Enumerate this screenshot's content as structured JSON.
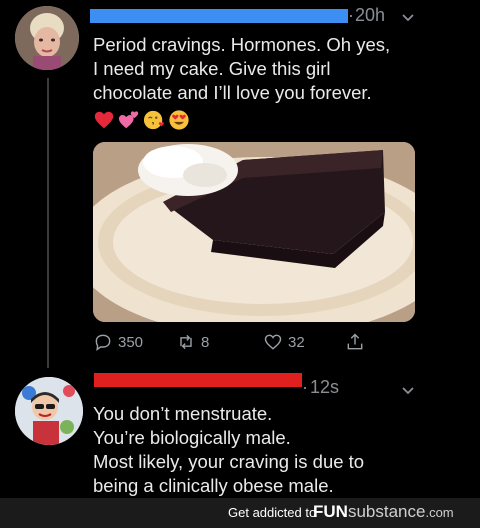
{
  "tweets": [
    {
      "time": "20h",
      "dot": "·",
      "lines": [
        "Period cravings. Hormones. Oh yes,",
        "I need my cake. Give this girl",
        "chocolate and I’ll love you forever."
      ],
      "emojis": [
        "red-heart",
        "two-hearts",
        "face-blowing-kiss",
        "heart-eyes-face"
      ],
      "stats": {
        "replies": "350",
        "retweets": "8",
        "likes": "32"
      },
      "icons": [
        "reply-icon",
        "retweet-icon",
        "like-icon",
        "share-icon"
      ]
    },
    {
      "time": "12s",
      "dot": "·",
      "lines": [
        "You don’t menstruate.",
        "You’re biologically male.",
        "Most likely, your craving is due to",
        "being a clinically obese male."
      ]
    }
  ],
  "watermark": {
    "text": "Get addicted to",
    "brand_strong": "FUN",
    "brand_light": "substance",
    "domain": ".com"
  },
  "colors": {
    "background": "#000000",
    "name_redaction_1": "#3d8ef2",
    "name_redaction_2": "#e0201f",
    "muted": "#8a8f95"
  }
}
